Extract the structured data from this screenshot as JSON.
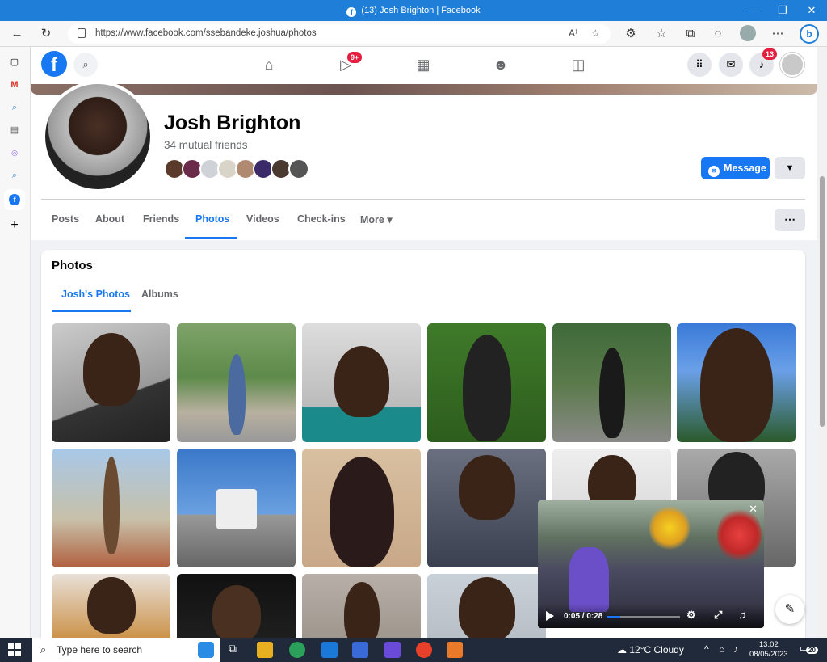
{
  "window": {
    "title": "(13) Josh Brighton | Facebook",
    "minimize": "—",
    "maximize": "❐",
    "close": "✕"
  },
  "browser": {
    "url": "https://www.facebook.com/ssebandeke.joshua/photos",
    "read_aloud_icon": "A⁾",
    "bing_label": "b"
  },
  "fbnav": {
    "logo": "f",
    "watch_badge": "9+",
    "notifications_badge": "13"
  },
  "profile": {
    "name": "Josh Brighton",
    "mutual_friends": "34 mutual friends",
    "message_button": "Message",
    "tabs": [
      {
        "label": "Posts"
      },
      {
        "label": "About"
      },
      {
        "label": "Friends"
      },
      {
        "label": "Photos"
      },
      {
        "label": "Videos"
      },
      {
        "label": "Check-ins"
      },
      {
        "label": "More ▾"
      }
    ],
    "active_tab": "Photos"
  },
  "photos": {
    "title": "Photos",
    "subtabs": [
      {
        "label": "Josh's Photos"
      },
      {
        "label": "Albums"
      }
    ]
  },
  "video": {
    "time": "0:05 / 0:28",
    "progress": 0.18
  },
  "taskbar": {
    "search_placeholder": "Type here to search",
    "weather": "12°C  Cloudy",
    "time": "13:02",
    "date": "08/05/2023",
    "notification_count": "20"
  },
  "colors": {
    "fb_blue": "#1877f2",
    "badge_red": "#e41e3f",
    "titlebar": "#1f7fd8",
    "taskbar": "#202a3a"
  }
}
